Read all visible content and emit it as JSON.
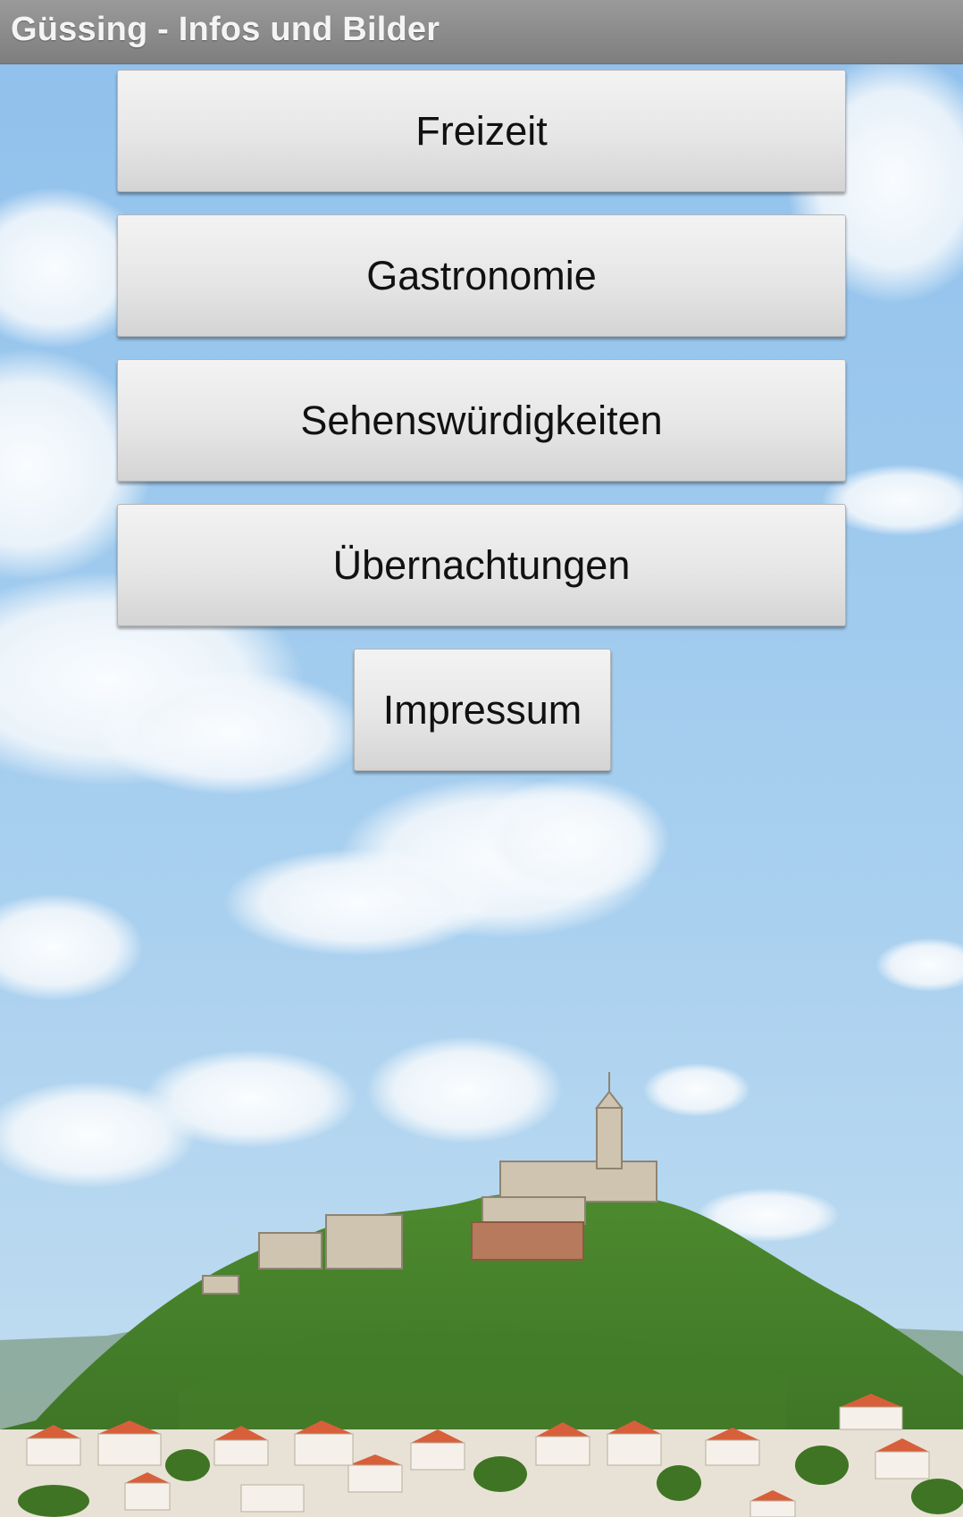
{
  "app": {
    "title": "Güssing - Infos und Bilder"
  },
  "menu": {
    "buttons": [
      {
        "label": "Freizeit"
      },
      {
        "label": "Gastronomie"
      },
      {
        "label": "Sehenswürdigkeiten"
      },
      {
        "label": "Übernachtungen"
      },
      {
        "label": "Impressum"
      }
    ]
  },
  "background": {
    "description_icon": "castle-hill-landscape-image"
  },
  "colors": {
    "titlebar": "#8c8c8c",
    "sky": "#9cc7ea",
    "button": "#e6e6e6"
  }
}
